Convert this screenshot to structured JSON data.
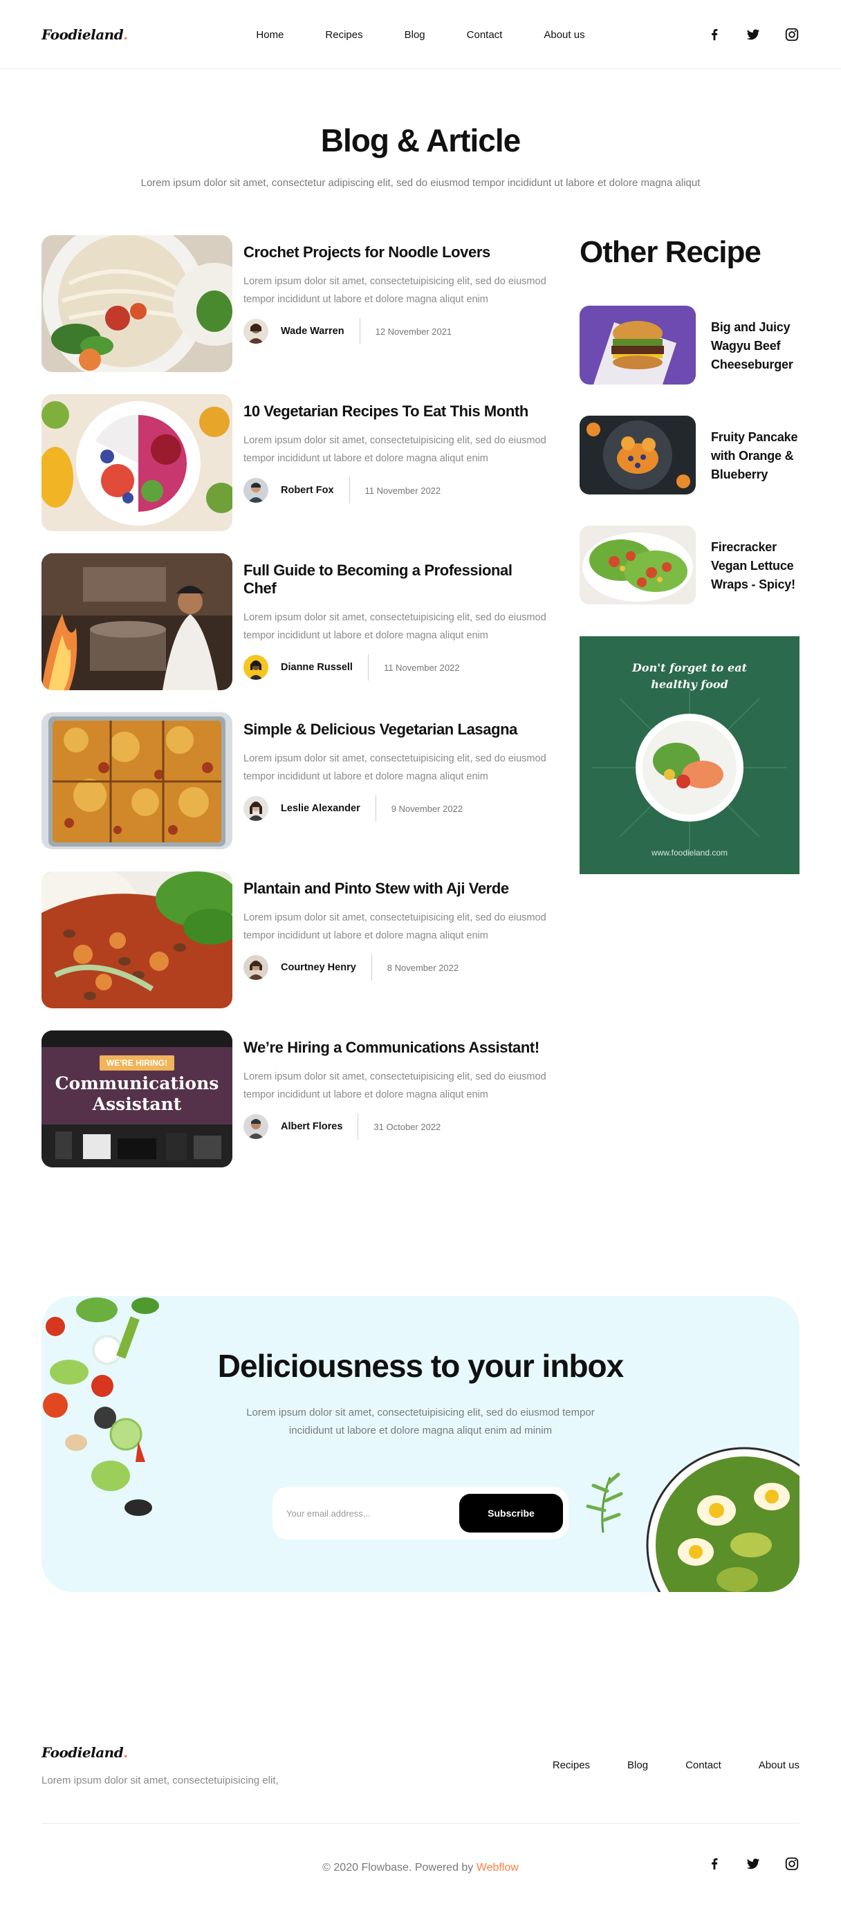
{
  "header": {
    "logo_text": "Foodieland",
    "logo_dot": ".",
    "nav": [
      "Home",
      "Recipes",
      "Blog",
      "Contact",
      "About us"
    ],
    "social_icons": [
      "facebook-icon",
      "twitter-icon",
      "instagram-icon"
    ]
  },
  "hero": {
    "title": "Blog & Article",
    "subtitle": "Lorem ipsum dolor sit amet, consectetur adipiscing elit, sed do eiusmod tempor incididunt ut labore et dolore magna aliqut"
  },
  "posts": [
    {
      "title": "Crochet Projects for Noodle Lovers",
      "text": "Lorem ipsum dolor sit amet, consectetuipisicing elit, sed do eiusmod tempor incididunt ut labore et dolore magna aliqut enim",
      "author": "Wade Warren",
      "date": "12 November 2021"
    },
    {
      "title": "10 Vegetarian Recipes To Eat This Month",
      "text": "Lorem ipsum dolor sit amet, consectetuipisicing elit, sed do eiusmod tempor incididunt ut labore et dolore magna aliqut enim",
      "author": "Robert Fox",
      "date": "11 November 2022"
    },
    {
      "title": "Full Guide to Becoming a Professional Chef",
      "text": "Lorem ipsum dolor sit amet, consectetuipisicing elit, sed do eiusmod tempor incididunt ut labore et dolore magna aliqut enim",
      "author": "Dianne Russell",
      "date": "11 November 2022"
    },
    {
      "title": "Simple & Delicious Vegetarian Lasagna",
      "text": "Lorem ipsum dolor sit amet, consectetuipisicing elit, sed do eiusmod tempor incididunt ut labore et dolore magna aliqut enim",
      "author": "Leslie Alexander",
      "date": "9 November 2022"
    },
    {
      "title": "Plantain and Pinto Stew with Aji Verde",
      "text": "Lorem ipsum dolor sit amet, consectetuipisicing elit, sed do eiusmod tempor incididunt ut labore et dolore magna aliqut enim",
      "author": "Courtney Henry",
      "date": "8 November 2022"
    },
    {
      "title": "We’re Hiring a Communications Assistant!",
      "text": "Lorem ipsum dolor sit amet, consectetuipisicing elit, sed do eiusmod tempor incididunt ut labore et dolore magna aliqut enim",
      "author": "Albert Flores",
      "date": "31 October 2022",
      "image_badge": "WE'RE HIRING!",
      "image_title_1": "Communications",
      "image_title_2": "Assistant"
    }
  ],
  "sidebar": {
    "title": "Other Recipe",
    "recipes": [
      {
        "name": "Big and Juicy Wagyu Beef Cheeseburger"
      },
      {
        "name": "Fruity Pancake with Orange & Blueberry"
      },
      {
        "name": "Firecracker Vegan Lettuce Wraps - Spicy!"
      }
    ],
    "ad": {
      "headline_1": "Don't forget to eat",
      "headline_2": "healthy food",
      "url": "www.foodieland.com"
    }
  },
  "newsletter": {
    "title": "Deliciousness to your inbox",
    "text": "Lorem ipsum dolor sit amet, consectetuipisicing elit, sed do eiusmod tempor incididunt ut labore et dolore magna aliqut enim ad minim",
    "input_placeholder": "Your email address...",
    "button_label": "Subscribe"
  },
  "footer": {
    "logo_text": "Foodieland",
    "logo_dot": ".",
    "text": "Lorem ipsum dolor sit amet, consectetuipisicing elit,",
    "nav": [
      "Recipes",
      "Blog",
      "Contact",
      "About us"
    ],
    "copyright_prefix": "© 2020 Flowbase. Powered by ",
    "copyright_link": "Webflow"
  },
  "colors": {
    "accent": "#ff7f45",
    "newsletter_bg": "#e7f9fd",
    "ad_bg": "#2b6a4c"
  }
}
